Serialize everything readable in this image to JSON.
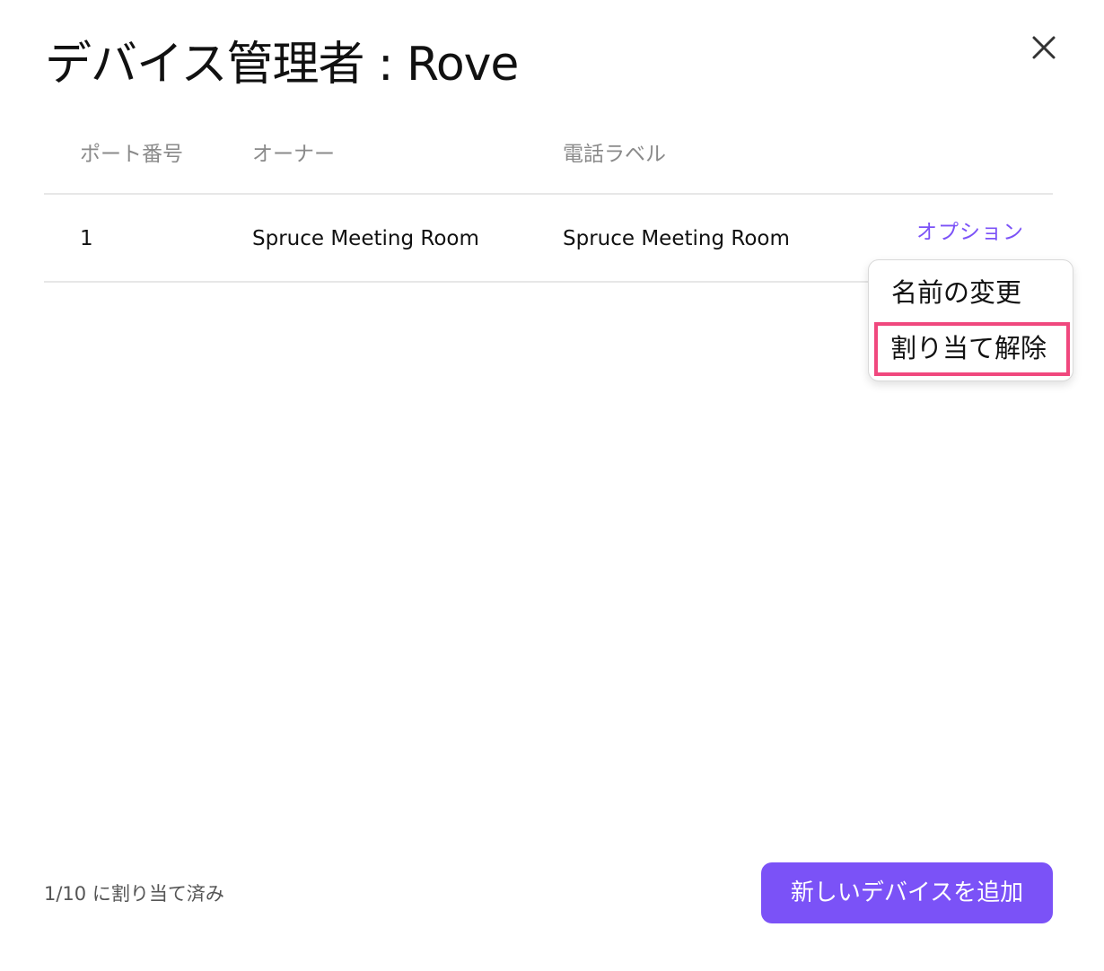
{
  "dialog": {
    "title": "デバイス管理者 : Rove",
    "close_icon": "close-icon"
  },
  "table": {
    "headers": [
      "ポート番号",
      "オーナー",
      "電話ラベル"
    ],
    "rows": [
      {
        "port": "1",
        "owner": "Spruce Meeting Room",
        "phone_label": "Spruce Meeting Room",
        "options_label": "オプション"
      }
    ]
  },
  "options_menu": {
    "items": [
      "名前の変更",
      "割り当て解除"
    ],
    "highlighted_item": "割り当て解除",
    "highlight_color": "#f0487e"
  },
  "footer": {
    "status": "1/10 に割り当て済み",
    "add_button_label": "新しいデバイスを追加"
  },
  "colors": {
    "accent": "#7b52f7",
    "header_text": "#8a8a8a"
  }
}
